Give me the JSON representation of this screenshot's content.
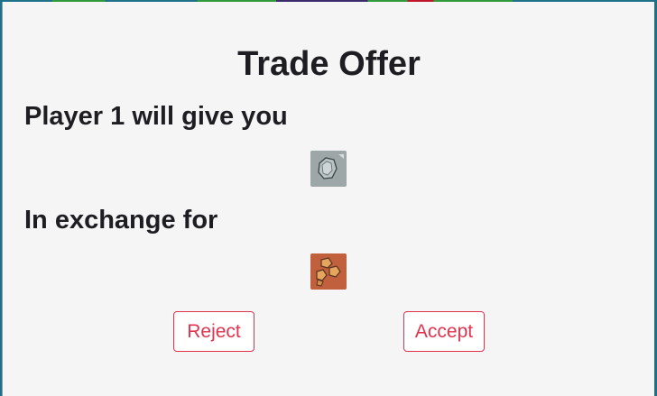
{
  "trade": {
    "title": "Trade Offer",
    "give_heading": "Player 1 will give you",
    "exchange_heading": "In exchange for",
    "give_resource_icon": "ore-icon",
    "receive_resource_icon": "brick-icon"
  },
  "actions": {
    "reject_label": "Reject",
    "accept_label": "Accept"
  },
  "colors": {
    "button_accent": "#e0334f",
    "ore_card": "#9ea7a8",
    "brick_card": "#c0603c",
    "modal_bg": "#f5f5f5"
  }
}
